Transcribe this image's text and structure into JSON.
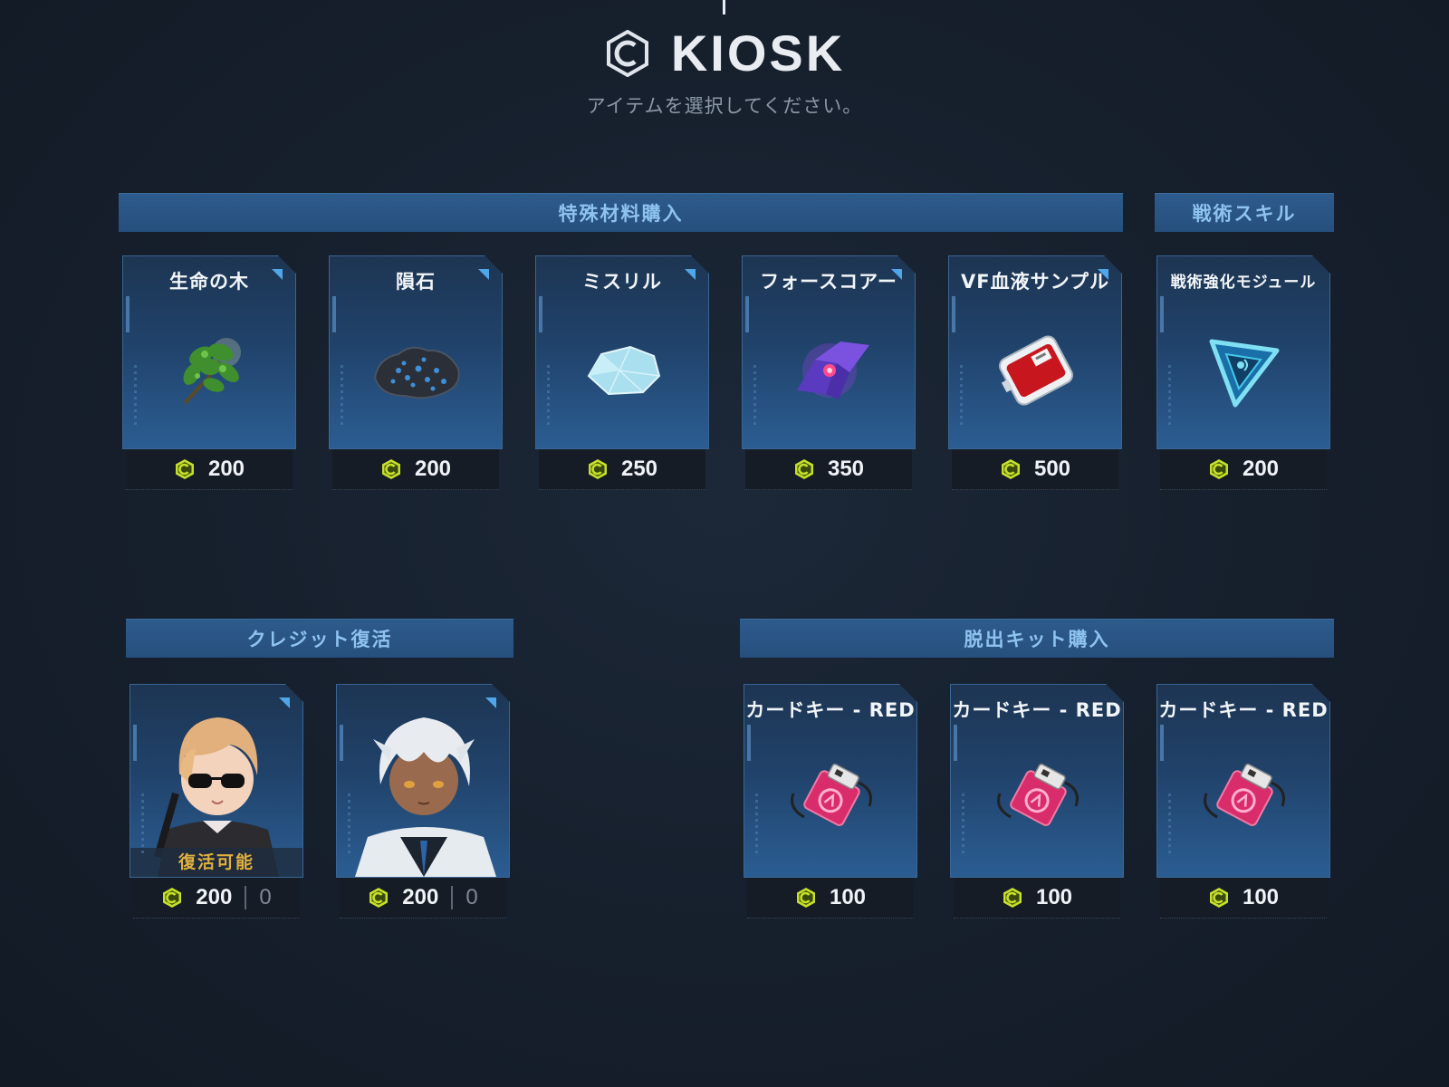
{
  "header": {
    "title": "KIOSK",
    "subtitle": "アイテムを選択してください。"
  },
  "sections": {
    "special_materials": "特殊材料購入",
    "tactical_skill": "戦術スキル",
    "credit_revive": "クレジット復活",
    "escape_kit": "脱出キット購入"
  },
  "materials": [
    {
      "name": "生命の木",
      "price": "200",
      "icon": "tree-branch-icon"
    },
    {
      "name": "隕石",
      "price": "200",
      "icon": "meteorite-icon"
    },
    {
      "name": "ミスリル",
      "price": "250",
      "icon": "mithril-icon"
    },
    {
      "name": "フォースコアー",
      "price": "350",
      "icon": "force-core-icon"
    },
    {
      "name": "VF血液サンプル",
      "price": "500",
      "icon": "blood-sample-icon"
    }
  ],
  "skill": {
    "name": "戦術強化モジュール",
    "price": "200",
    "icon": "tactical-module-icon"
  },
  "revive": [
    {
      "price": "200",
      "count": "0",
      "status": "復活可能",
      "icon": "character-blonde-sunglasses"
    },
    {
      "price": "200",
      "count": "0",
      "icon": "character-white-hair"
    }
  ],
  "kits": [
    {
      "name": "カードキー - RED",
      "price": "100",
      "icon": "card-key-icon"
    },
    {
      "name": "カードキー - RED",
      "price": "100",
      "icon": "card-key-icon"
    },
    {
      "name": "カードキー - RED",
      "price": "100",
      "icon": "card-key-icon"
    }
  ],
  "colors": {
    "coin": "#c6e02a",
    "accent": "#4fa6e8",
    "section": "#2a5585",
    "revive_text": "#e0b040"
  }
}
